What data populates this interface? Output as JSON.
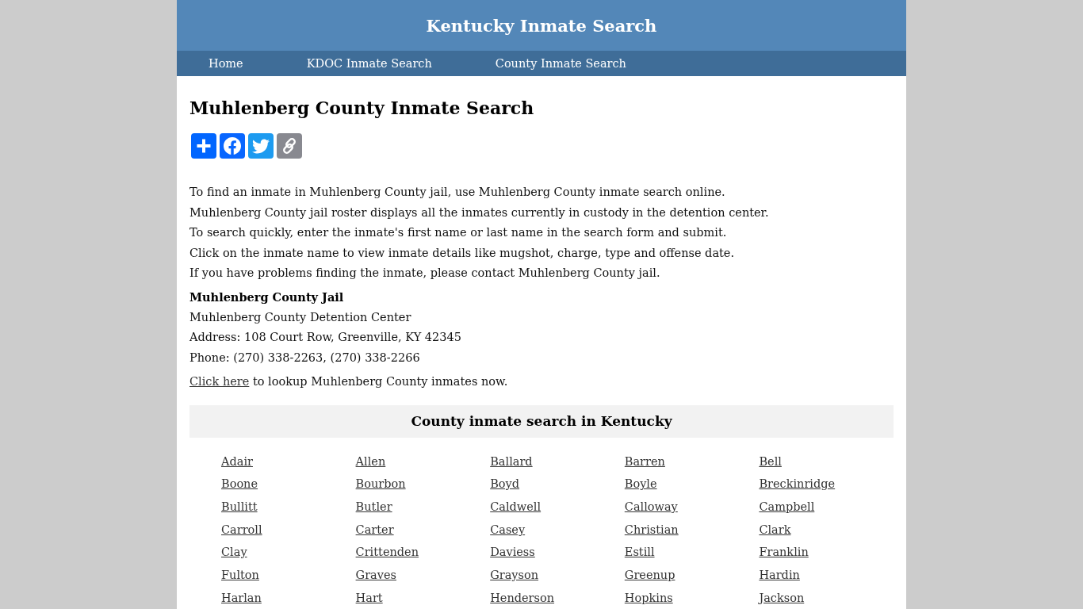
{
  "header": {
    "site_title": "Kentucky Inmate Search"
  },
  "nav": [
    "Home",
    "KDOC Inmate Search",
    "County Inmate Search"
  ],
  "page_title": "Muhlenberg County Inmate Search",
  "share_buttons": [
    {
      "kind": "share"
    },
    {
      "kind": "facebook"
    },
    {
      "kind": "twitter"
    },
    {
      "kind": "copy_link"
    }
  ],
  "intro_lines": [
    "To find an inmate in Muhlenberg County jail, use Muhlenberg County inmate search online.",
    "Muhlenberg County jail roster displays all the inmates currently in custody in the detention center.",
    "To search quickly, enter the inmate's first name or last name in the search form and submit.",
    "Click on the inmate name to view inmate details like mugshot, charge, type and offense date.",
    "If you have problems finding the inmate, please contact Muhlenberg County jail."
  ],
  "jail": {
    "name": "Muhlenberg County Jail",
    "lines": [
      "Muhlenberg County Detention Center",
      "Address: 108 Court Row, Greenville, KY 42345",
      "Phone: (270) 338-2263, (270) 338-2266"
    ]
  },
  "lookup": {
    "link": "Click here",
    "text": " to lookup Muhlenberg County inmates now."
  },
  "county_section": {
    "title": "County inmate search in Kentucky",
    "counties": [
      "Adair",
      "Allen",
      "Ballard",
      "Barren",
      "Bell",
      "Boone",
      "Bourbon",
      "Boyd",
      "Boyle",
      "Breckinridge",
      "Bullitt",
      "Butler",
      "Caldwell",
      "Calloway",
      "Campbell",
      "Carroll",
      "Carter",
      "Casey",
      "Christian",
      "Clark",
      "Clay",
      "Crittenden",
      "Daviess",
      "Estill",
      "Franklin",
      "Fulton",
      "Graves",
      "Grayson",
      "Greenup",
      "Hardin",
      "Harlan",
      "Hart",
      "Henderson",
      "Hopkins",
      "Jackson"
    ]
  }
}
